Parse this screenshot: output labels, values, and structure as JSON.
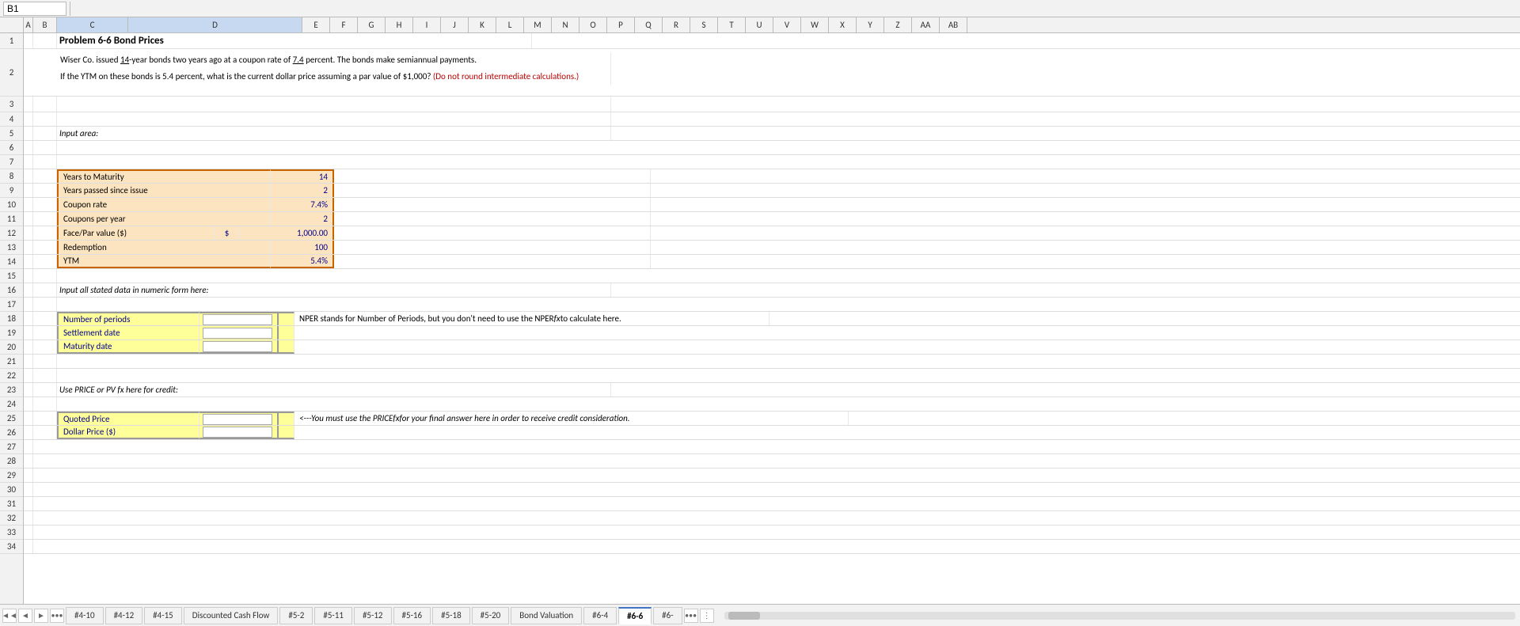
{
  "formulaBar": {
    "nameBox": "B1",
    "content": ""
  },
  "columns": [
    "A",
    "B",
    "C",
    "D",
    "E",
    "F",
    "G",
    "H",
    "I",
    "J",
    "K",
    "L",
    "M",
    "N",
    "O",
    "P",
    "Q",
    "R",
    "S",
    "T",
    "U",
    "V",
    "W",
    "X",
    "Y",
    "Z",
    "AA",
    "AB"
  ],
  "rows": [
    1,
    2,
    3,
    4,
    5,
    6,
    7,
    8,
    9,
    10,
    11,
    12,
    13,
    14,
    15,
    16,
    17,
    18,
    19,
    20,
    21,
    22,
    23,
    24,
    25,
    26,
    27,
    28,
    29,
    30,
    31,
    32,
    33,
    34
  ],
  "title": "Problem 6-6 Bond Prices",
  "problemText1": "Wiser Co. issued 14-year bonds two years ago at a coupon rate of 7.4 percent. The bonds make semiannual payments.",
  "problemText1_underline": "14",
  "problemText2a": "If the YTM on these bonds is 5.4 percent, what is the current dollar price assuming a par value of $1,000?",
  "problemText2b": "(Do not round",
  "problemText2c": "intermediate calculations.)",
  "inputAreaLabel": "Input area:",
  "inputBox": {
    "rows": [
      {
        "label": "Years to Maturity",
        "value": "14",
        "hasDollar": false,
        "dollar": ""
      },
      {
        "label": "Years passed since issue",
        "value": "2",
        "hasDollar": false,
        "dollar": ""
      },
      {
        "label": "Coupon rate",
        "value": "7.4%",
        "hasDollar": false,
        "dollar": ""
      },
      {
        "label": "Coupons per year",
        "value": "2",
        "hasDollar": false,
        "dollar": ""
      },
      {
        "label": "Face/Par value ($)",
        "value": "1,000.00",
        "hasDollar": true,
        "dollar": "$"
      },
      {
        "label": "Redemption",
        "value": "100",
        "hasDollar": false,
        "dollar": ""
      },
      {
        "label": "YTM",
        "value": "5.4%",
        "hasDollar": false,
        "dollar": ""
      }
    ]
  },
  "inputAllLabel": "Input all stated data in numeric form here:",
  "periodsBox": {
    "rows": [
      {
        "label": "Number of periods",
        "hasInput": true
      },
      {
        "label": "Settlement date",
        "hasInput": true
      },
      {
        "label": "Maturity date",
        "hasInput": true
      }
    ]
  },
  "nperText": "NPER stands for Number of Periods, but you don't need to use the NPER",
  "nperFx": "fx",
  "nperText2": " to calculate here.",
  "usePriceLabel": "Use PRICE or PV fx here for credit:",
  "priceBox": {
    "rows": [
      {
        "label": "Quoted Price",
        "hasInput": true
      },
      {
        "label": "Dollar Price ($)",
        "hasInput": true
      }
    ]
  },
  "creditText1": "<---You must use the PRICE",
  "creditFx": "fx",
  "creditText2": " for your final answer here in order to receive credit consideration.",
  "tabs": [
    {
      "id": "4-10",
      "label": "#4-10",
      "active": false
    },
    {
      "id": "4-12",
      "label": "#4-12",
      "active": false
    },
    {
      "id": "4-15",
      "label": "#4-15",
      "active": false
    },
    {
      "id": "dcf",
      "label": "Discounted Cash Flow",
      "active": false
    },
    {
      "id": "5-2",
      "label": "#5-2",
      "active": false
    },
    {
      "id": "5-11",
      "label": "#5-11",
      "active": false
    },
    {
      "id": "5-12",
      "label": "#5-12",
      "active": false
    },
    {
      "id": "5-16",
      "label": "#5-16",
      "active": false
    },
    {
      "id": "5-18",
      "label": "#5-18",
      "active": false
    },
    {
      "id": "5-20",
      "label": "#5-20",
      "active": false
    },
    {
      "id": "bond-val",
      "label": "Bond Valuation",
      "active": false
    },
    {
      "id": "6-4",
      "label": "#6-4",
      "active": false
    },
    {
      "id": "6-6",
      "label": "#6-6",
      "active": true
    },
    {
      "id": "6-more",
      "label": "#6-",
      "active": false
    }
  ],
  "colors": {
    "orange_bg": "#fce4c0",
    "orange_border": "#c86400",
    "yellow_bg": "#ffff99",
    "yellow_border": "#999900",
    "blue_value": "#00008b",
    "red_text": "#c00000",
    "active_tab_accent": "#4472c4"
  }
}
